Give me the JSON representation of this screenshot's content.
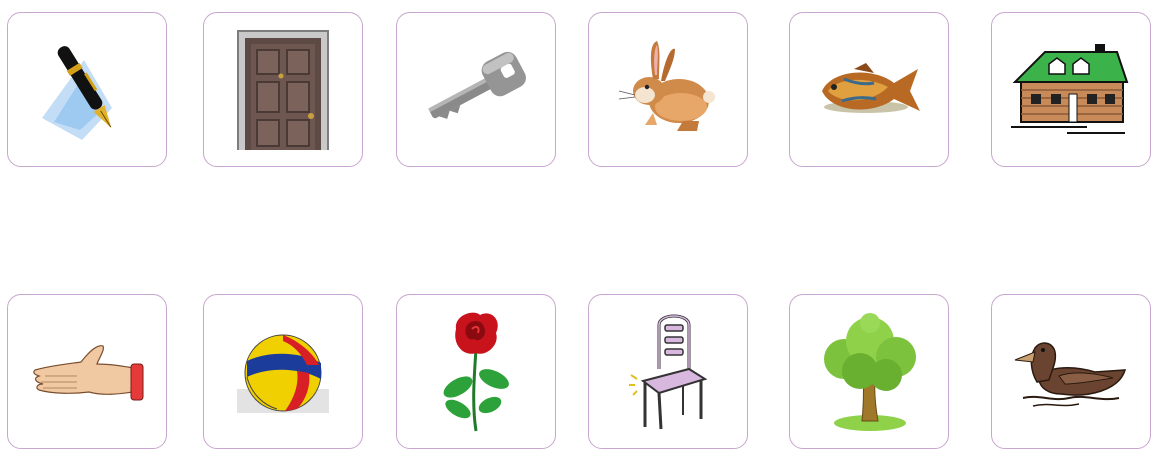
{
  "colors": {
    "card_border": "#c9a6cf",
    "background": "#ffffff"
  },
  "grid": {
    "rows": [
      {
        "cards": [
          {
            "icon": "pen-icon"
          },
          {
            "icon": "door-icon"
          },
          {
            "icon": "key-icon"
          },
          {
            "icon": "rabbit-icon"
          },
          {
            "icon": "fish-icon"
          },
          {
            "icon": "house-icon"
          }
        ]
      },
      {
        "cards": [
          {
            "icon": "hand-icon"
          },
          {
            "icon": "ball-icon"
          },
          {
            "icon": "rose-icon"
          },
          {
            "icon": "chair-icon"
          },
          {
            "icon": "tree-icon"
          },
          {
            "icon": "duck-icon"
          }
        ]
      }
    ]
  }
}
